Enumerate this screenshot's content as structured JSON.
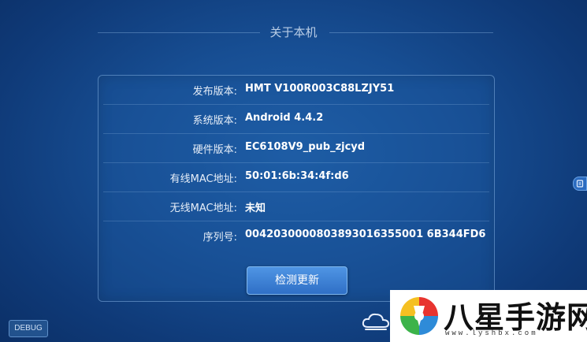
{
  "screen": {
    "title": "关于本机"
  },
  "info_rows": [
    {
      "label": "发布版本:",
      "value": "HMT V100R003C88LZJY51"
    },
    {
      "label": "系统版本:",
      "value": "Android 4.4.2"
    },
    {
      "label": "硬件版本:",
      "value": "EC6108V9_pub_zjcyd"
    },
    {
      "label": "有线MAC地址:",
      "value": "50:01:6b:34:4f:d6"
    },
    {
      "label": "无线MAC地址:",
      "value": "未知"
    },
    {
      "label": "序列号:",
      "value": "0042030000803893016355001 6B344FD6"
    }
  ],
  "actions": {
    "check_update_label": "检测更新",
    "debug_label": "DEBUG"
  },
  "watermark": {
    "brand": "八星手游网",
    "url": "www.lyshbx.com"
  },
  "colors": {
    "background": "#174e93",
    "button": "#3a7fd6",
    "panel_border": "#7fa9dc"
  }
}
